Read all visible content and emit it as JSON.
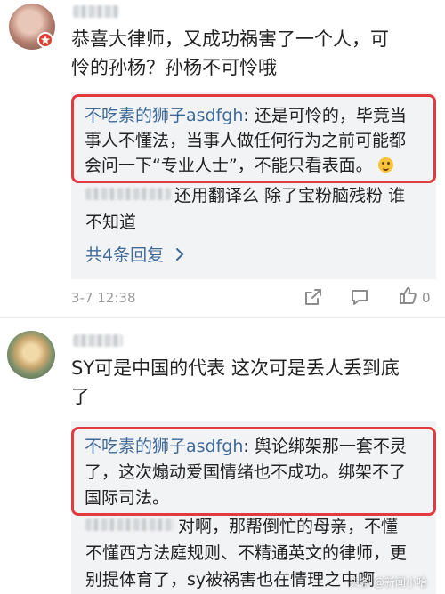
{
  "comment1": {
    "text_line1": "恭喜大律师，又成功祸害了一个人，可",
    "text_line2": "怜的孙杨？孙杨不可怜哦",
    "highlighted_reply": {
      "name": "不吃素的狮子asdfgh",
      "line1": ": 还是可怜的，毕竟当",
      "line2": "事人不懂法，当事人做任何行为之前可能都",
      "line3": "会问一下“专业人士”，不能只看表面。"
    },
    "reply2": {
      "line1": "还用翻译么 除了宝粉脑残粉 谁",
      "line2": "不知道"
    },
    "more_replies": "共4条回复",
    "time": "3-7 12:38",
    "like_count": "0"
  },
  "comment2": {
    "text_line1": "SY可是中国的代表 这次可是丢人丢到底",
    "text_line2": "了",
    "highlighted_reply": {
      "name": "不吃素的狮子asdfgh",
      "line1": ": 舆论绑架那一套不灵",
      "line2": "了，这次煽动爱国情绪也不成功。绑架不了",
      "line3": "国际司法。"
    },
    "reply2": {
      "line1": "对啊，那帮倒忙的母亲，不懂",
      "line2": "不懂西方法庭规则、不精通英文的律师，更",
      "line3": "别提体育了，sy被祸害也在情理之中啊"
    }
  },
  "watermark": "头条 @新闻小哈",
  "colors": {
    "link_blue": "#3f6a98",
    "highlight_red": "#e23b3f",
    "reply_bg": "#f2f3f5"
  }
}
